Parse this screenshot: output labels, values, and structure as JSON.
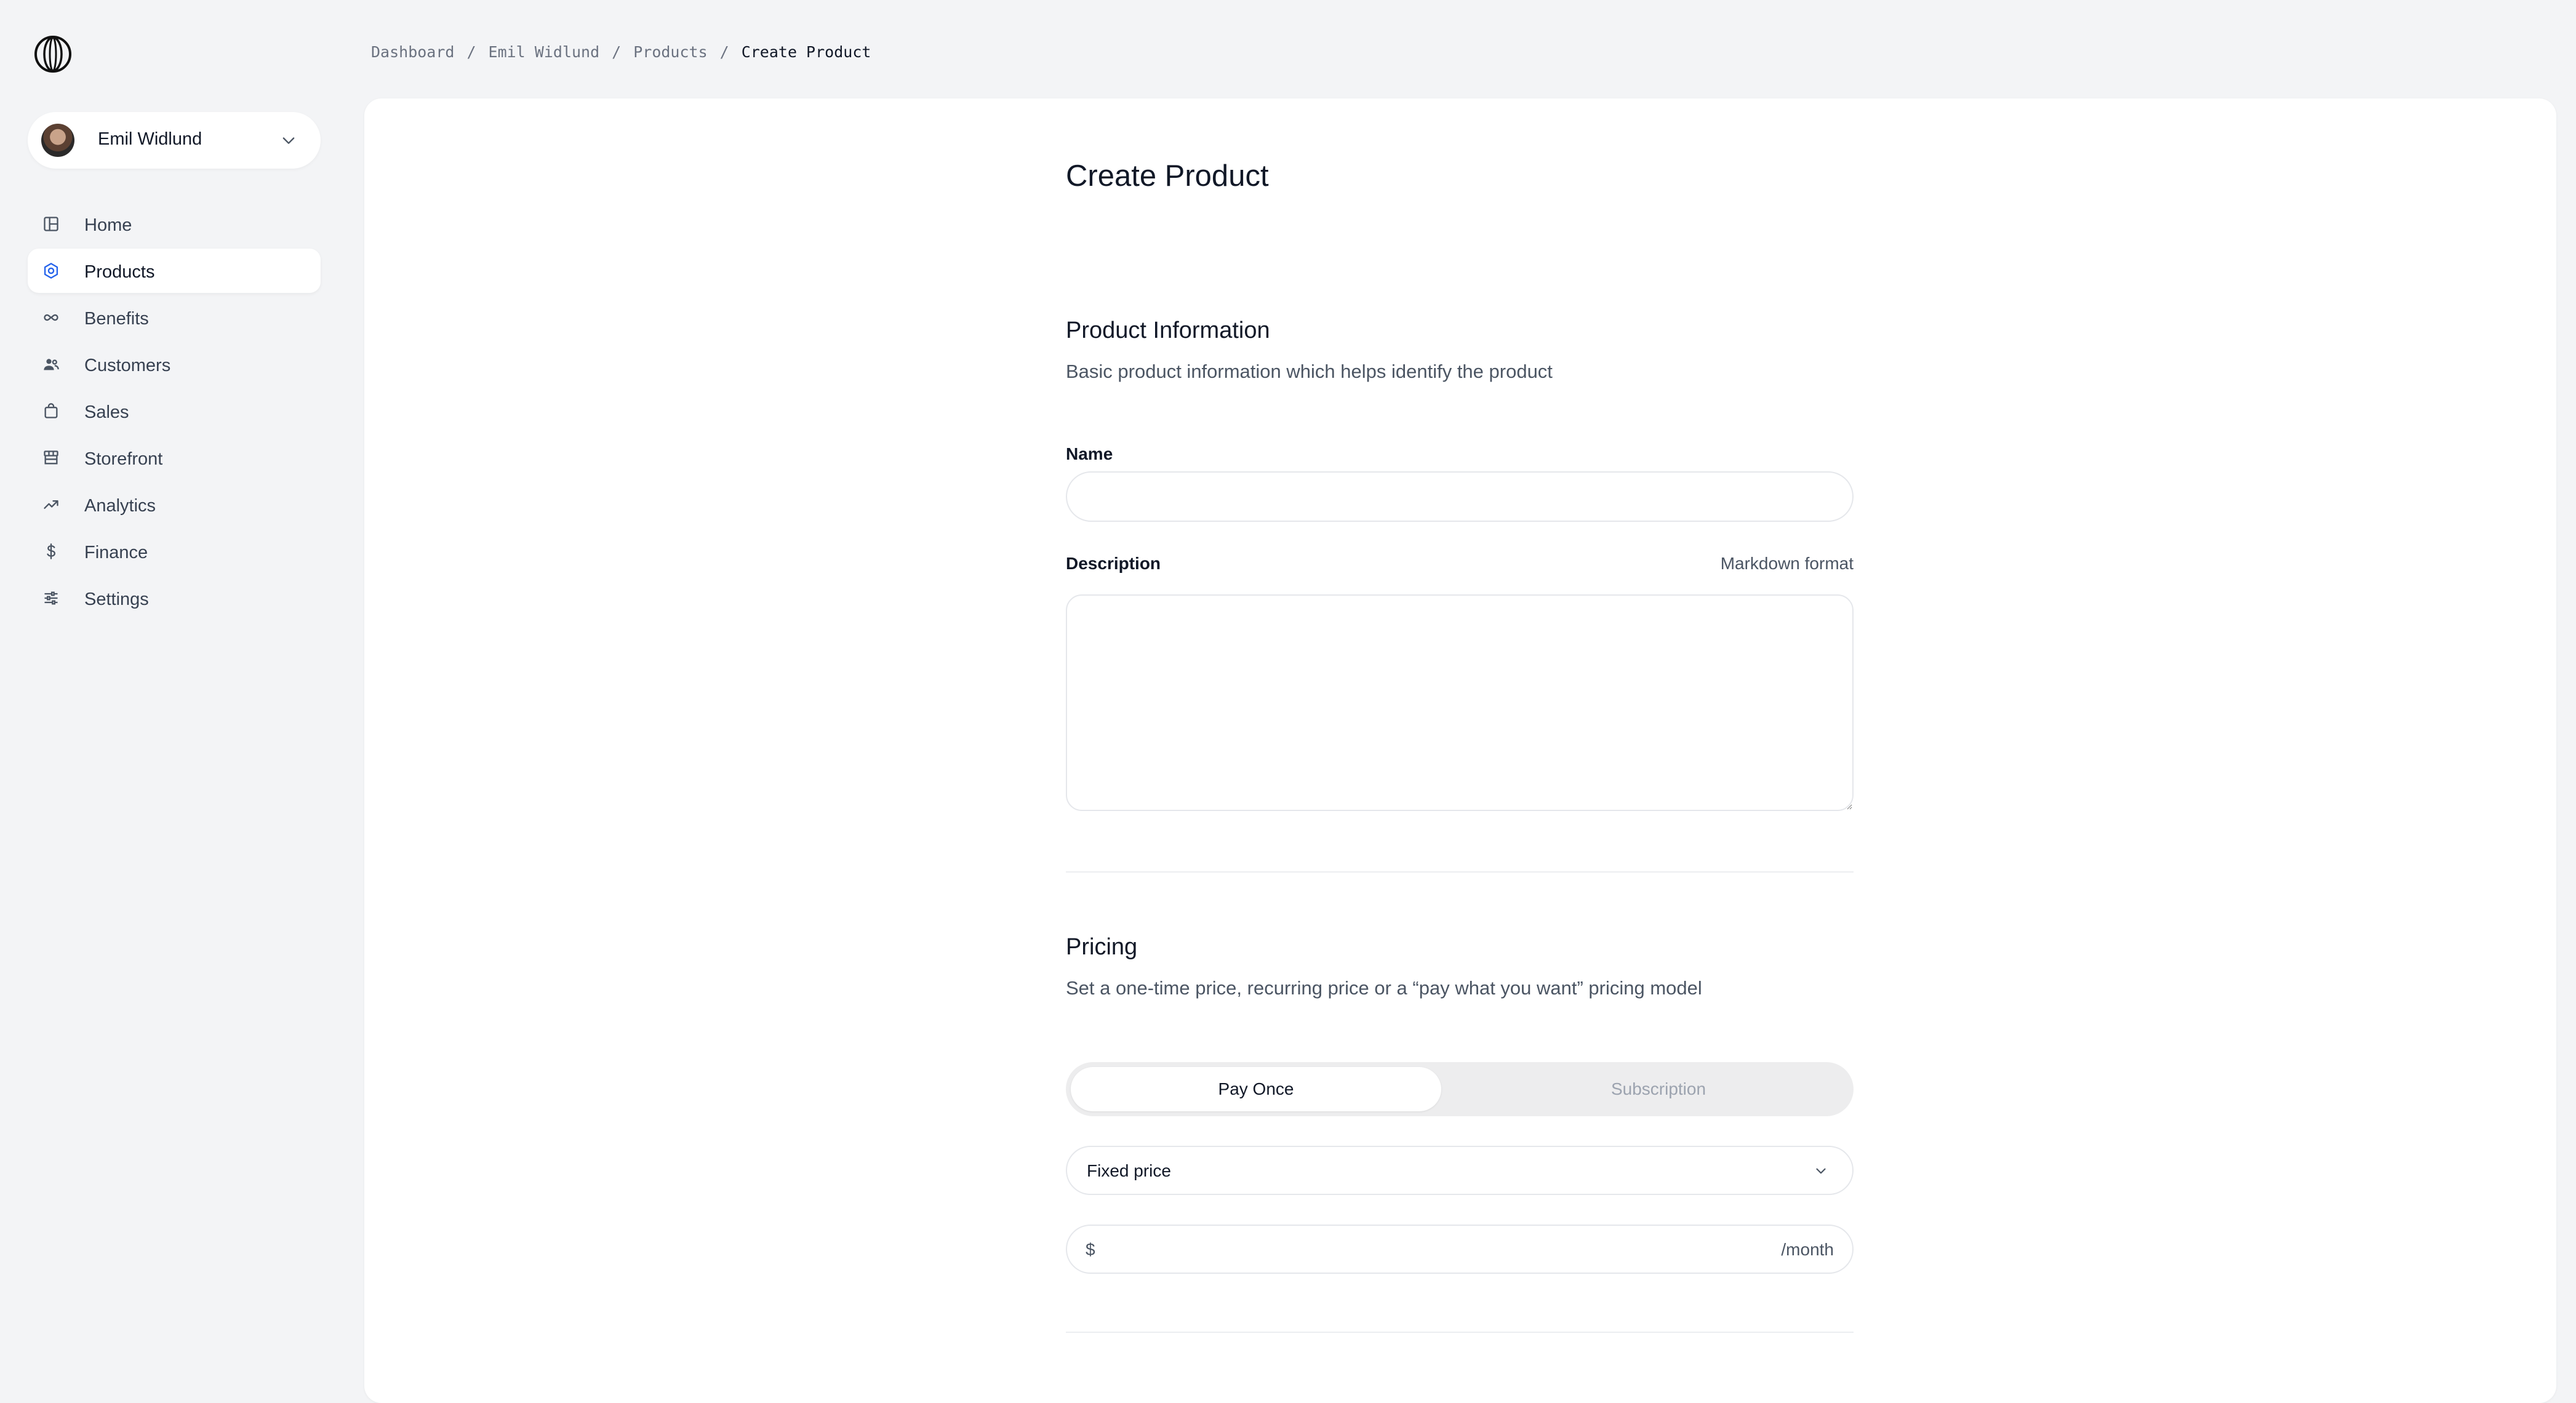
{
  "breadcrumb": {
    "items": [
      "Dashboard",
      "Emil Widlund",
      "Products",
      "Create Product"
    ],
    "separator": "/"
  },
  "sidebar": {
    "logo_icon": "polar-logo-icon",
    "account": {
      "name": "Emil Widlund",
      "avatar_icon": "avatar"
    },
    "items": [
      {
        "label": "Home",
        "icon": "layout-icon"
      },
      {
        "label": "Products",
        "icon": "product-hexagon-icon",
        "active": true
      },
      {
        "label": "Benefits",
        "icon": "infinity-icon"
      },
      {
        "label": "Customers",
        "icon": "people-icon"
      },
      {
        "label": "Sales",
        "icon": "shopping-bag-icon"
      },
      {
        "label": "Storefront",
        "icon": "storefront-icon"
      },
      {
        "label": "Analytics",
        "icon": "trending-up-icon"
      },
      {
        "label": "Finance",
        "icon": "dollar-icon"
      },
      {
        "label": "Settings",
        "icon": "sliders-icon"
      }
    ]
  },
  "main": {
    "title": "Create Product",
    "product_info": {
      "title": "Product Information",
      "subtitle": "Basic product information which helps identify the product",
      "name_label": "Name",
      "name_value": "",
      "description_label": "Description",
      "description_hint": "Markdown format",
      "description_value": ""
    },
    "pricing": {
      "title": "Pricing",
      "subtitle": "Set a one-time price, recurring price or a “pay what you want” pricing model",
      "tabs": [
        "Pay Once",
        "Subscription"
      ],
      "selected_tab": "Pay Once",
      "price_type": "Fixed price",
      "currency_symbol": "$",
      "price_value": "",
      "interval_suffix": "/month"
    }
  },
  "colors": {
    "background": "#f3f4f6",
    "panel": "#ffffff",
    "accent": "#2563eb",
    "text": "#111827",
    "muted": "#6b7280"
  }
}
